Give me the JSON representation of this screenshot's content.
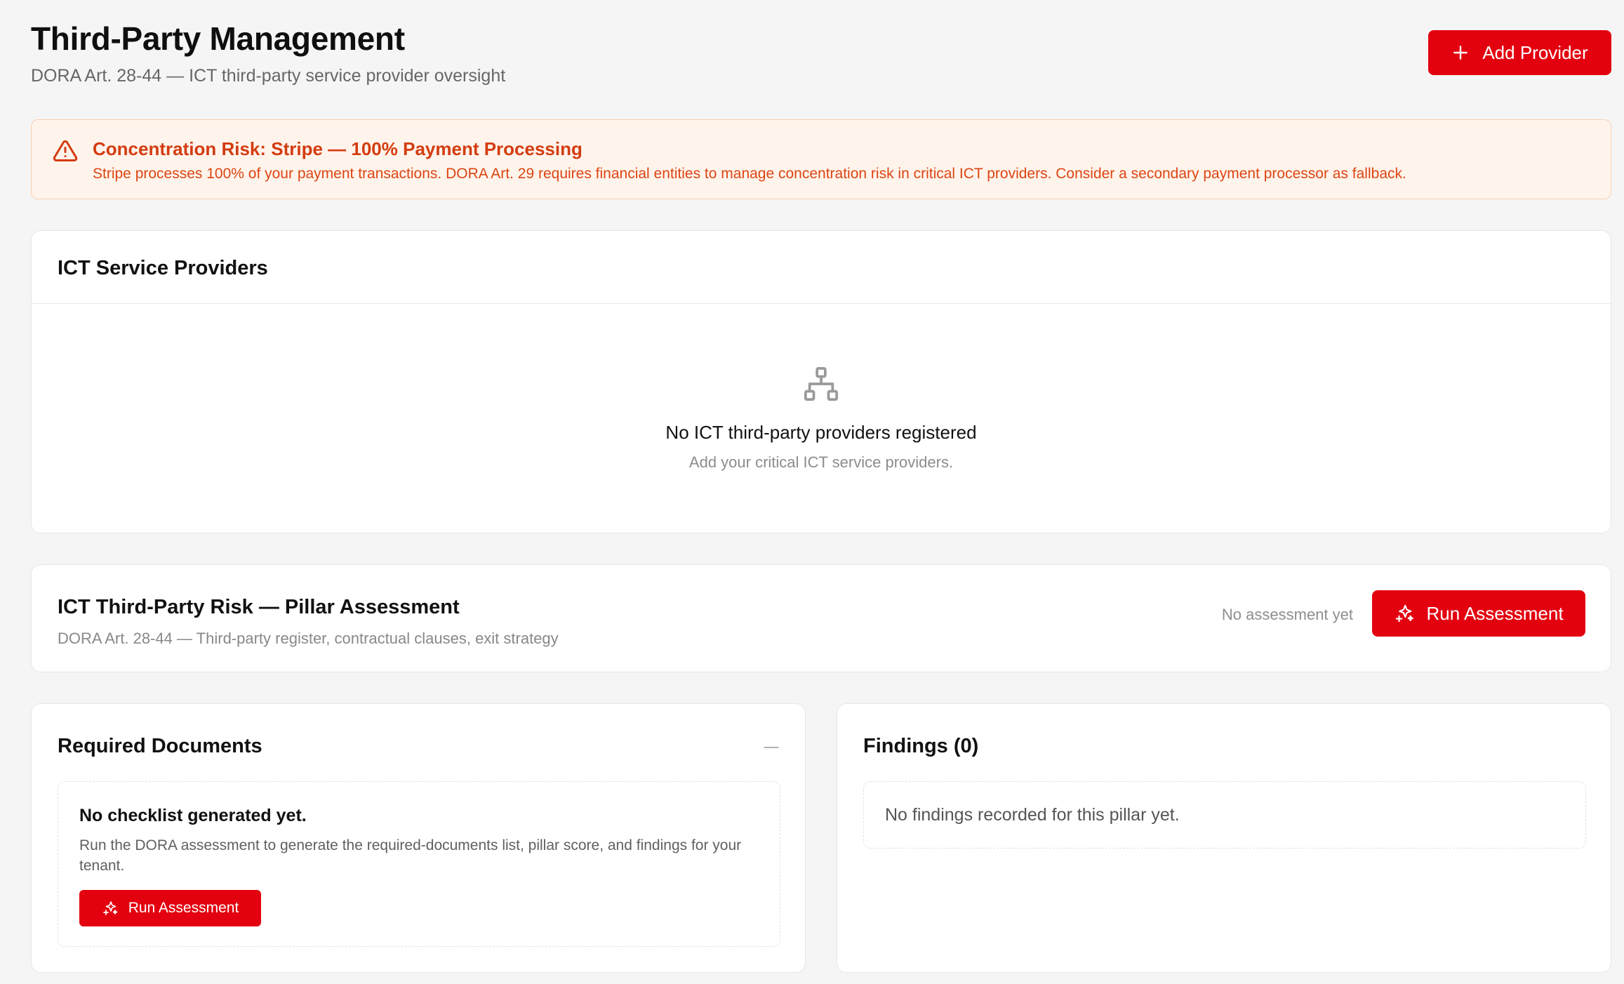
{
  "header": {
    "title": "Third-Party Management",
    "subtitle": "DORA Art. 28-44 — ICT third-party service provider oversight",
    "add_provider_label": "Add Provider"
  },
  "alert": {
    "title": "Concentration Risk: Stripe — 100% Payment Processing",
    "body": "Stripe processes 100% of your payment transactions. DORA Art. 29 requires financial entities to manage concentration risk in critical ICT providers. Consider a secondary payment processor as fallback."
  },
  "providers": {
    "title": "ICT Service Providers",
    "empty_title": "No ICT third-party providers registered",
    "empty_subtitle": "Add your critical ICT service providers."
  },
  "pillar": {
    "title": "ICT Third-Party Risk — Pillar Assessment",
    "subtitle": "DORA Art. 28-44 — Third-party register, contractual clauses, exit strategy",
    "status": "No assessment yet",
    "run_label": "Run Assessment"
  },
  "documents": {
    "title": "Required Documents",
    "empty_title": "No checklist generated yet.",
    "empty_text": "Run the DORA assessment to generate the required-documents list, pillar score, and findings for your tenant.",
    "run_label": "Run Assessment"
  },
  "findings": {
    "title": "Findings (0)",
    "empty_text": "No findings recorded for this pillar yet."
  },
  "colors": {
    "accent": "#e3000f",
    "warning_text": "#d33c10",
    "warning_bg": "#fff4ec",
    "page_bg": "#f5f5f5"
  },
  "icons": {
    "add": "plus-icon",
    "alert": "warning-triangle-icon",
    "providers_empty": "network-hierarchy-icon",
    "run": "sparkles-icon",
    "collapse": "minus-icon"
  }
}
